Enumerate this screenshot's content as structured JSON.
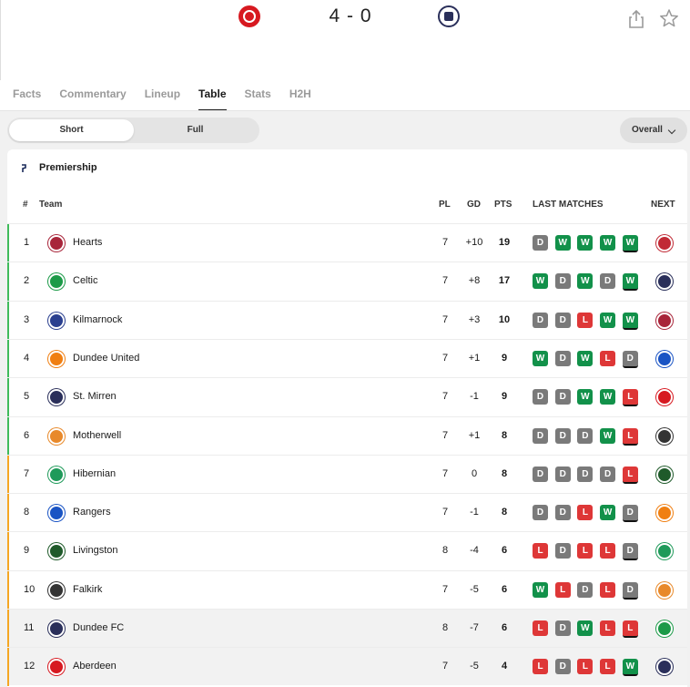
{
  "match": {
    "score": "4 - 0",
    "home_crest": "aberdeen-crest-icon",
    "away_crest": "dundee-fc-crest-icon"
  },
  "actions": {
    "share": "share-icon",
    "favourite": "star-icon"
  },
  "tabs": [
    {
      "label": "Facts",
      "active": false
    },
    {
      "label": "Commentary",
      "active": false
    },
    {
      "label": "Lineup",
      "active": false
    },
    {
      "label": "Table",
      "active": true
    },
    {
      "label": "Stats",
      "active": false
    },
    {
      "label": "H2H",
      "active": false
    }
  ],
  "toggle": {
    "short_label": "Short",
    "full_label": "Full",
    "selected": "Short"
  },
  "filter": {
    "label": "Overall"
  },
  "league": {
    "name": "Premiership",
    "icon": "premiership-logo-icon"
  },
  "headers": {
    "pos": "#",
    "team": "Team",
    "pl": "PL",
    "gd": "GD",
    "pts": "PTS",
    "form": "LAST MATCHES",
    "next": "NEXT"
  },
  "colors": {
    "win": "#12914a",
    "draw": "#7a7a7a",
    "loss": "#de3737",
    "zone_top": "#3fbb5b",
    "zone_bottom": "#f5a623"
  },
  "rows": [
    {
      "pos": "1",
      "team": "Hearts",
      "pl": "7",
      "gd": "+10",
      "pts": "19",
      "form": [
        "D",
        "W",
        "W",
        "W",
        "W"
      ],
      "zone": "top",
      "logo": "#a8253a",
      "next": "#c12a35"
    },
    {
      "pos": "2",
      "team": "Celtic",
      "pl": "7",
      "gd": "+8",
      "pts": "17",
      "form": [
        "W",
        "D",
        "W",
        "D",
        "W"
      ],
      "zone": "top",
      "logo": "#1c9a48",
      "next": "#2a2f5a"
    },
    {
      "pos": "3",
      "team": "Kilmarnock",
      "pl": "7",
      "gd": "+3",
      "pts": "10",
      "form": [
        "D",
        "D",
        "L",
        "W",
        "W"
      ],
      "zone": "top",
      "logo": "#2a3f8f",
      "next": "#a8253a"
    },
    {
      "pos": "4",
      "team": "Dundee United",
      "pl": "7",
      "gd": "+1",
      "pts": "9",
      "form": [
        "W",
        "D",
        "W",
        "L",
        "D"
      ],
      "zone": "top",
      "logo": "#f07f12",
      "next": "#1a54c4"
    },
    {
      "pos": "5",
      "team": "St. Mirren",
      "pl": "7",
      "gd": "-1",
      "pts": "9",
      "form": [
        "D",
        "D",
        "W",
        "W",
        "L"
      ],
      "zone": "top",
      "logo": "#2a2f5a",
      "next": "#d71920"
    },
    {
      "pos": "6",
      "team": "Motherwell",
      "pl": "7",
      "gd": "+1",
      "pts": "8",
      "form": [
        "D",
        "D",
        "D",
        "W",
        "L"
      ],
      "zone": "top",
      "logo": "#e8892a",
      "next": "#333333"
    },
    {
      "pos": "7",
      "team": "Hibernian",
      "pl": "7",
      "gd": "0",
      "pts": "8",
      "form": [
        "D",
        "D",
        "D",
        "D",
        "L"
      ],
      "zone": "bottom",
      "logo": "#1f9a5a",
      "next": "#1f5a2a"
    },
    {
      "pos": "8",
      "team": "Rangers",
      "pl": "7",
      "gd": "-1",
      "pts": "8",
      "form": [
        "D",
        "D",
        "L",
        "W",
        "D"
      ],
      "zone": "bottom",
      "logo": "#1a54c4",
      "next": "#f07f12"
    },
    {
      "pos": "9",
      "team": "Livingston",
      "pl": "8",
      "gd": "-4",
      "pts": "6",
      "form": [
        "L",
        "D",
        "L",
        "L",
        "D"
      ],
      "zone": "bottom",
      "logo": "#1f5a2a",
      "next": "#1f9a5a"
    },
    {
      "pos": "10",
      "team": "Falkirk",
      "pl": "7",
      "gd": "-5",
      "pts": "6",
      "form": [
        "W",
        "L",
        "D",
        "L",
        "D"
      ],
      "zone": "bottom",
      "logo": "#333333",
      "next": "#e8892a"
    },
    {
      "pos": "11",
      "team": "Dundee FC",
      "pl": "8",
      "gd": "-7",
      "pts": "6",
      "form": [
        "L",
        "D",
        "W",
        "L",
        "L"
      ],
      "zone": "bottom",
      "logo": "#2a2f5a",
      "next": "#1c9a48",
      "highlight": true
    },
    {
      "pos": "12",
      "team": "Aberdeen",
      "pl": "7",
      "gd": "-5",
      "pts": "4",
      "form": [
        "L",
        "D",
        "L",
        "L",
        "W"
      ],
      "zone": "bottom",
      "logo": "#d71920",
      "next": "#2a2f5a",
      "highlight": true
    }
  ]
}
